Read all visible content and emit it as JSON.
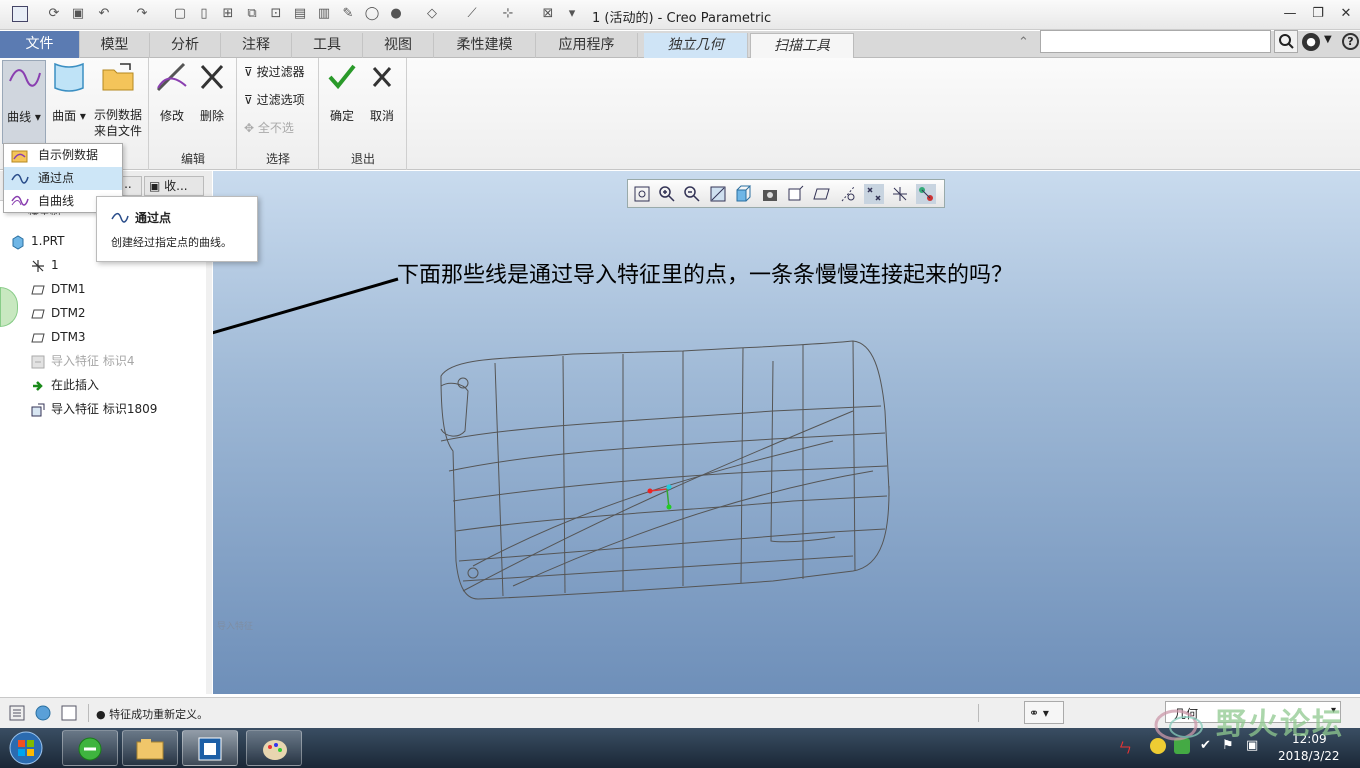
{
  "title_bar": {
    "app_title": "1 (活动的) - Creo Parametric"
  },
  "tabs": [
    {
      "label": "文件"
    },
    {
      "label": "模型"
    },
    {
      "label": "分析"
    },
    {
      "label": "注释"
    },
    {
      "label": "工具"
    },
    {
      "label": "视图"
    },
    {
      "label": "柔性建模"
    },
    {
      "label": "应用程序"
    },
    {
      "label": "独立几何"
    },
    {
      "label": "扫描工具"
    }
  ],
  "ribbon": {
    "curve_label": "曲线",
    "surface_label": "曲面",
    "sample_data_label_1": "示例数据",
    "sample_data_label_2": "来自文件",
    "modify_label": "修改",
    "delete_label": "删除",
    "edit_group": "编辑",
    "by_filter_label": "按过滤器",
    "filter_options_label": "过滤选项",
    "deselect_all_label": "全不选",
    "select_group": "选择",
    "ok_label": "确定",
    "cancel_label": "取消",
    "exit_group": "退出"
  },
  "curve_menu": {
    "items": [
      {
        "label": "自示例数据"
      },
      {
        "label": "通过点"
      },
      {
        "label": "自曲线"
      }
    ]
  },
  "tooltip": {
    "title": "通过点",
    "description": "创建经过指定点的曲线。"
  },
  "panel": {
    "tab_ellipsis": "...",
    "tab_label": "收...",
    "header": "模型树",
    "tree": [
      {
        "label": "1.PRT"
      },
      {
        "label": "1"
      },
      {
        "label": "DTM1"
      },
      {
        "label": "DTM2"
      },
      {
        "label": "DTM3"
      },
      {
        "label": "导入特征 标识4"
      },
      {
        "label": "在此插入"
      },
      {
        "label": "导入特征 标识1809"
      }
    ]
  },
  "graphics": {
    "annotation": "下面那些线是通过导入特征里的点，一条条慢慢连接起来的吗？",
    "small_label": "导入特征"
  },
  "status": {
    "message": "特征成功重新定义。",
    "filter_value": "几何"
  },
  "taskbar": {
    "time": "12:09",
    "date": "2018/3/22"
  },
  "watermark": {
    "text": "野火论坛"
  },
  "colors": {
    "file_tab": "#5b7bb2",
    "context_tab": "#cfe4f6",
    "menu_hover": "#cde6f7",
    "viewport_top": "#c9dbee",
    "viewport_bottom": "#6e8fb9"
  }
}
